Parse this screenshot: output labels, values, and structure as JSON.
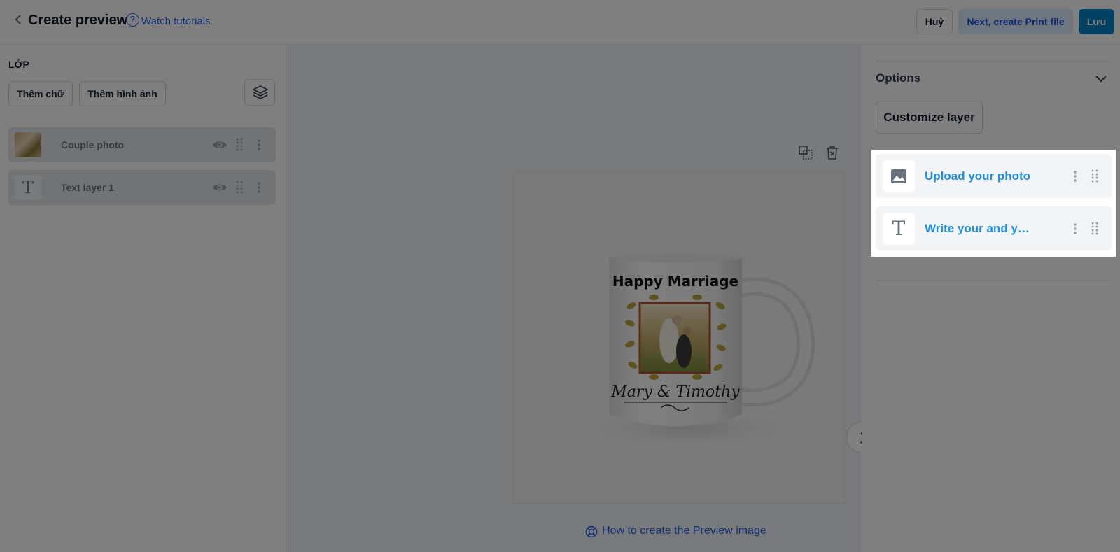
{
  "header": {
    "back_icon": "chevron-left-icon",
    "title": "Create preview",
    "help_icon": "question-circle-icon",
    "watch_tutorials": "Watch tutorials",
    "cancel_label": "Huỷ",
    "next_label": "Next, create Print file",
    "save_label": "Lưu",
    "accent_color": "#0284c7"
  },
  "layers_panel": {
    "title": "LỚP",
    "add_text_label": "Thêm chữ",
    "add_image_label": "Thêm hình ảnh",
    "layers_icon": "layers-icon",
    "items": [
      {
        "name": "Couple photo",
        "type": "image",
        "visible_icon": "eye-icon"
      },
      {
        "name": "Text layer 1",
        "type": "text",
        "visible_icon": "eye-icon"
      }
    ]
  },
  "canvas": {
    "copy_icon": "duplicate-icon",
    "delete_icon": "trash-icon",
    "mug_title": "Happy Marriage",
    "mug_names": "Mary & Timothy",
    "next_icon": "chevron-right-icon",
    "help_link": "How to create the Preview image",
    "help_link_icon": "lifebuoy-icon"
  },
  "options_panel": {
    "title": "Options",
    "collapse_icon": "chevron-down-icon",
    "customize_label": "Customize layer",
    "items": [
      {
        "label": "Upload your photo",
        "icon": "image-icon"
      },
      {
        "label": "Write your and y…",
        "icon": "text-icon"
      }
    ]
  }
}
